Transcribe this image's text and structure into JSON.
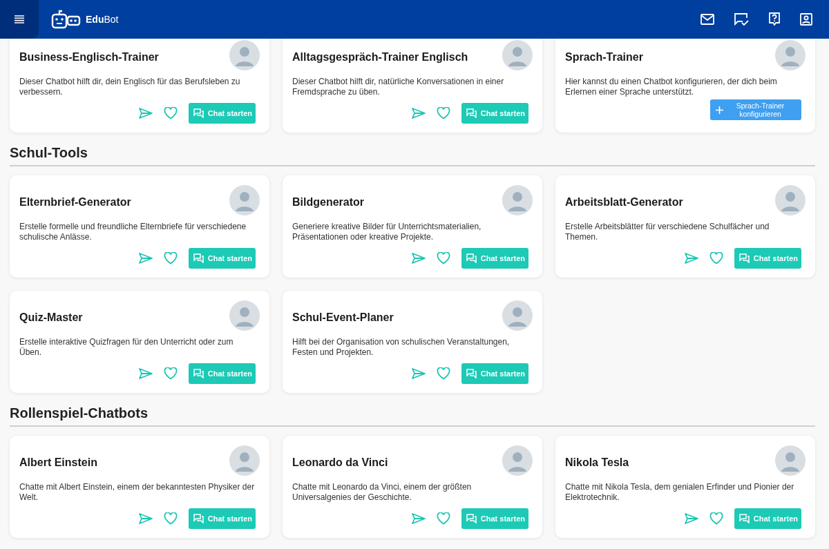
{
  "header": {
    "logo": "**Edu**Bot"
  },
  "top_cards": [
    {
      "kind": "chat",
      "title": "Business-Englisch-Trainer",
      "description": "Dieser Chatbot hilft dir, dein Englisch für das Berufsleben zu verbessern.",
      "button": "Chat starten"
    },
    {
      "kind": "chat",
      "title": "Alltagsgespräch-Trainer Englisch",
      "description": "Dieser Chatbot hilft dir, natürliche Konversationen in einer Fremdsprache zu üben.",
      "button": "Chat starten"
    },
    {
      "kind": "configure",
      "title": "Sprach-Trainer",
      "description": "Hier kannst du einen Chatbot konfigurieren, der dich beim Erlernen einer Sprache unterstützt.",
      "button": "Sprach-Trainer konfigurieren"
    }
  ],
  "sections": [
    {
      "heading": "Schul-Tools",
      "cards": [
        {
          "kind": "chat",
          "title": "Elternbrief-Generator",
          "description": "Erstelle formelle und freundliche Elternbriefe für verschiedene schulische Anlässe.",
          "button": "Chat starten"
        },
        {
          "kind": "chat",
          "title": "Bildgenerator",
          "description": "Generiere kreative Bilder für Unterrichtsmaterialien, Präsentationen oder kreative Projekte.",
          "button": "Chat starten"
        },
        {
          "kind": "chat",
          "title": "Arbeitsblatt-Generator",
          "description": "Erstelle Arbeitsblätter für verschiedene Schulfächer und Themen.",
          "button": "Chat starten"
        },
        {
          "kind": "chat",
          "title": "Quiz-Master",
          "description": "Erstelle interaktive Quizfragen für den Unterricht oder zum Üben.",
          "button": "Chat starten"
        },
        {
          "kind": "chat",
          "title": "Schul-Event-Planer",
          "description": "Hilft bei der Organisation von schulischen Veranstaltungen, Festen und Projekten.",
          "button": "Chat starten"
        }
      ]
    },
    {
      "heading": "Rollenspiel-Chatbots",
      "cards": [
        {
          "kind": "chat",
          "title": "Albert Einstein",
          "description": "Chatte mit Albert Einstein, einem der bekanntesten Physiker der Welt.",
          "button": "Chat starten"
        },
        {
          "kind": "chat",
          "title": "Leonardo da Vinci",
          "description": "Chatte mit Leonardo da Vinci, einem der größten Universalgenies der Geschichte.",
          "button": "Chat starten"
        },
        {
          "kind": "chat",
          "title": "Nikola Tesla",
          "description": "Chatte mit Nikola Tesla, dem genialen Erfinder und Pionier der Elektrotechnik.",
          "button": "Chat starten"
        }
      ]
    }
  ]
}
